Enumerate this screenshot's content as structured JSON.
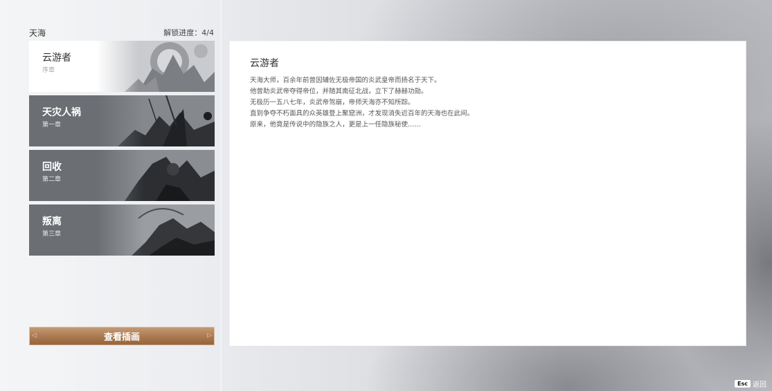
{
  "header": {
    "title": "天海",
    "progress": "解锁进度：4/4"
  },
  "chapters": [
    {
      "title": "云游者",
      "subtitle": "序章",
      "active": true
    },
    {
      "title": "天灾人祸",
      "subtitle": "第一章",
      "active": false
    },
    {
      "title": "回收",
      "subtitle": "第二章",
      "active": false
    },
    {
      "title": "叛离",
      "subtitle": "第三章",
      "active": false
    }
  ],
  "view_button": {
    "label": "查看插画"
  },
  "detail": {
    "title": "云游者",
    "lines": [
      "天海大师，百余年前曾因辅佐无极帝国的炎武皇帝而扬名于天下。",
      "他曾助炎武帝夺得帝位，并随其南征北战，立下了赫赫功勋。",
      "无极历一五八七年，炎武帝驾崩，帝师天海亦不知所踪。",
      "直到争夺不朽面具的众英雄登上聚窟洲，才发现消失近百年的天海也在此间。",
      "原来，他竟是传说中的隐族之人，更是上一任隐族秘使……"
    ]
  },
  "footer": {
    "esc_key": "Esc",
    "esc_label": "返回"
  },
  "colors": {
    "accent_button": "#a9784f",
    "card_dark": "#6b6e73",
    "card_active": "#ffffff"
  },
  "icons": {
    "back": "esc-key-icon"
  }
}
